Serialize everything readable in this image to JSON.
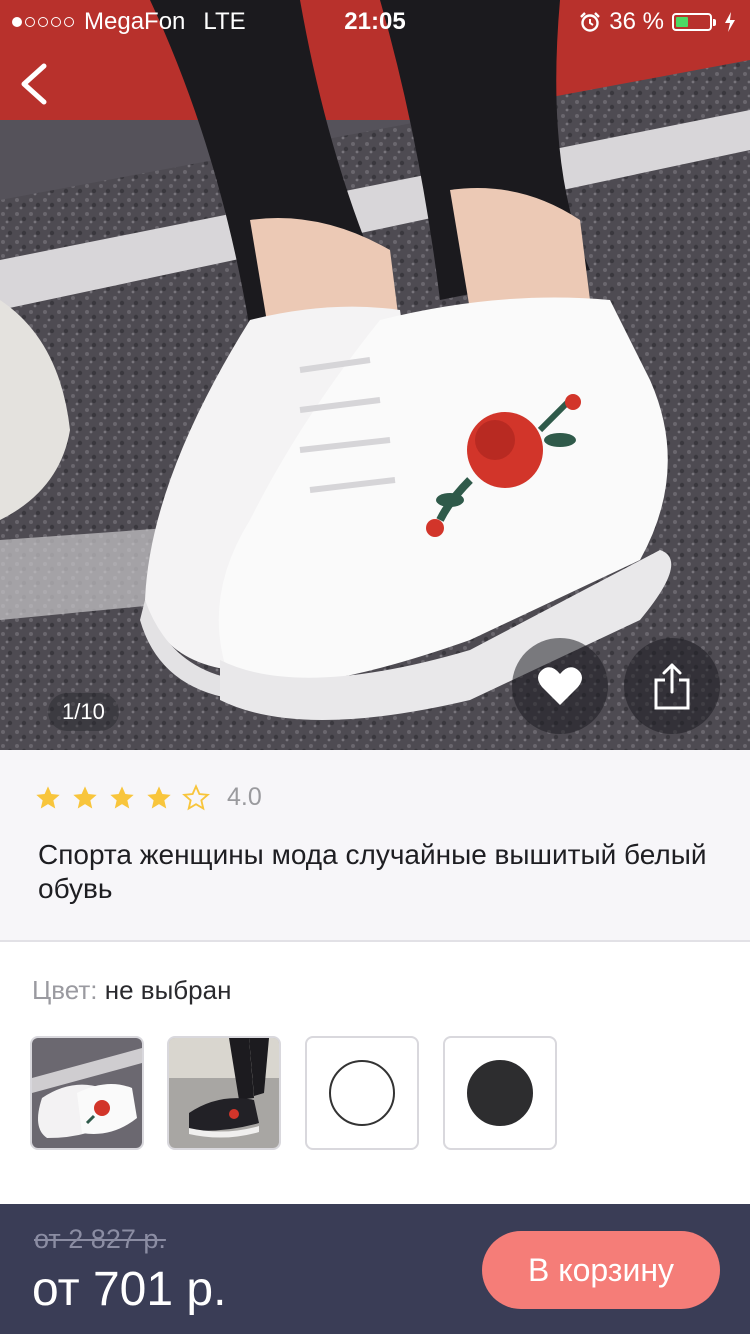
{
  "status_bar": {
    "signal_dots_filled": 1,
    "carrier": "MegaFon",
    "network": "LTE",
    "time": "21:05",
    "battery_text": "36 %",
    "battery_level": 0.36,
    "icons": [
      "alarm-icon",
      "battery-icon",
      "charging-bolt-icon"
    ]
  },
  "gallery": {
    "counter": "1/10",
    "icons": {
      "back": "chevron-left-icon",
      "favorite": "heart-icon",
      "share": "share-icon"
    }
  },
  "product": {
    "rating_stars": 4,
    "rating_max": 5,
    "rating_value": "4.0",
    "title": "Спорта женщины мода случайные вышитый белый обувь"
  },
  "color": {
    "label": "Цвет:",
    "value": "не выбран",
    "swatches": [
      {
        "type": "photo",
        "name": "white-embroidered"
      },
      {
        "type": "photo",
        "name": "black-model"
      },
      {
        "type": "color",
        "color": "#ffffff"
      },
      {
        "type": "color",
        "color": "#2d2d2f"
      }
    ]
  },
  "purchase": {
    "old_price": "от 2 827 р.",
    "new_price": "от 701 р.",
    "cart_button": "В корзину",
    "accent_color": "#f57d78",
    "bar_color": "#3a3d56"
  }
}
